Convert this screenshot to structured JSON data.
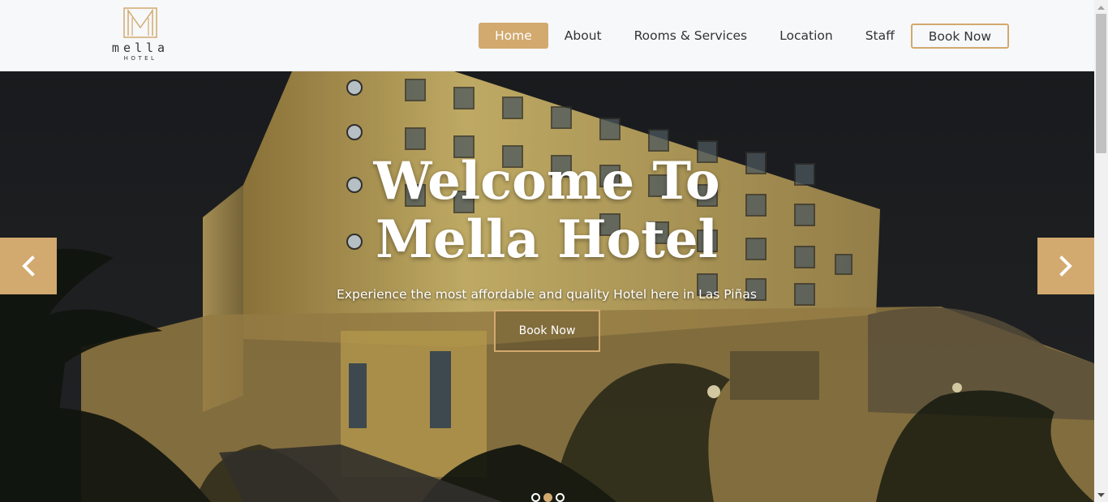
{
  "brand": {
    "logo_word": "mella",
    "logo_sub": "HOTEL",
    "accent_color": "#d2a96e"
  },
  "nav": {
    "items": [
      {
        "label": "Home",
        "active": true
      },
      {
        "label": "About",
        "active": false
      },
      {
        "label": "Rooms & Services",
        "active": false
      },
      {
        "label": "Location",
        "active": false
      },
      {
        "label": "Staff",
        "active": false
      }
    ],
    "book_label": "Book Now"
  },
  "hero": {
    "title_line1": "Welcome To",
    "title_line2": "Mella Hotel",
    "subtitle": "Experience the most affordable and quality Hotel here in Las Piñas",
    "button_label": "Book Now",
    "prev_icon": "chevron-left-icon",
    "next_icon": "chevron-right-icon",
    "slides": 3,
    "active_slide": 2
  }
}
